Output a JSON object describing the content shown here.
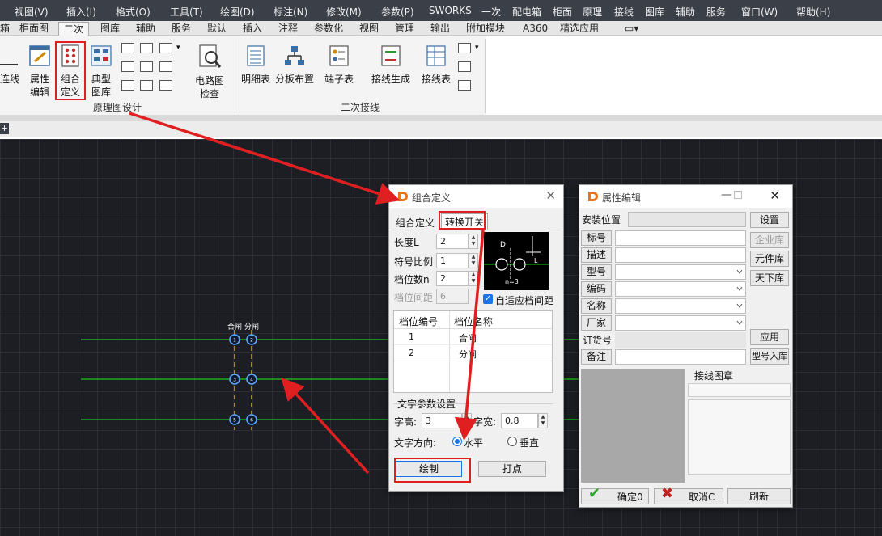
{
  "menubar": {
    "items": [
      "视图(V)",
      "插入(I)",
      "格式(O)",
      "工具(T)",
      "绘图(D)",
      "标注(N)",
      "修改(M)",
      "参数(P)",
      "SWORKS",
      "一次",
      "配电箱",
      "柜面",
      "原理",
      "接线",
      "图库",
      "辅助",
      "服务",
      "窗口(W)",
      "帮助(H)"
    ]
  },
  "ribbon_tabs": {
    "items": [
      "箱",
      "柜面图",
      "二次",
      "图库",
      "辅助",
      "服务",
      "默认",
      "插入",
      "注释",
      "参数化",
      "视图",
      "管理",
      "输出",
      "附加模块",
      "A360",
      "精选应用"
    ],
    "active": "二次"
  },
  "ribbon": {
    "btn_lianxian": "连线",
    "btn_attr_edit": "属性\n编辑",
    "btn_combo_define": "组合\n定义",
    "btn_typical_lib": "典型\n图库",
    "btn_circuit_check": "电路图\n检查",
    "btn_detail_table": "明细表",
    "btn_panel_layout": "分板布置",
    "btn_terminal_table": "端子表",
    "btn_wiring_gen": "接线生成",
    "btn_wiring_table": "接线表",
    "panel_schematic": "原理图设计",
    "panel_secondary_wiring": "二次接线",
    "plus_tab": "+"
  },
  "canvas": {
    "label_left": "合闸",
    "label_right": "分闸",
    "pos_labels": [
      "1",
      "2",
      "3",
      "4",
      "5",
      "6"
    ]
  },
  "combo_dialog": {
    "title": "组合定义",
    "tabs": [
      "组合定义",
      "转换开关"
    ],
    "length_label": "长度L",
    "length_value": "2",
    "scale_label": "符号比例",
    "scale_value": "1",
    "positions_label": "档位数n",
    "positions_value": "2",
    "spacing_label": "档位间距",
    "spacing_value": "6",
    "adaptive_label": "自适应档间距",
    "adaptive_checked": true,
    "preview_labels": {
      "d": "D",
      "l": "L",
      "n": "n=3"
    },
    "table_headers": [
      "档位编号",
      "档位名称"
    ],
    "table_rows": [
      {
        "no": "1",
        "name": "合闸"
      },
      {
        "no": "2",
        "name": "分闸"
      }
    ],
    "text_group_label": "文字参数设置",
    "font_height_label": "字高:",
    "font_height_value": "3",
    "font_width_label": "字宽:",
    "font_width_value": "0.8",
    "direction_label": "文字方向:",
    "dir_horizontal": "水平",
    "dir_vertical": "垂直",
    "dir_selected": "水平",
    "draw_button": "绘制",
    "dot_button": "打点"
  },
  "attr_dialog": {
    "title": "属性编辑",
    "install_pos_label": "安装位置",
    "settings_button": "设置",
    "fields": [
      "标号",
      "描述",
      "型号",
      "编码",
      "名称",
      "厂家",
      "订货号",
      "备注"
    ],
    "enterprise_lib_button": "企业库",
    "component_lib_button": "元件库",
    "tianxia_lib_button": "天下库",
    "apply_button": "应用",
    "model_in_lib_button": "型号入库",
    "wiring_chapter_label": "接线图章",
    "ok_button": "确定0",
    "cancel_button": "取消C",
    "refresh_button": "刷新"
  },
  "colors": {
    "accent_red": "#e02020",
    "wire_green": "#1ec81e",
    "node_blue": "#5aa7ff",
    "dash_yellow": "#e6c020",
    "canvas_bg": "#1c1e24"
  }
}
